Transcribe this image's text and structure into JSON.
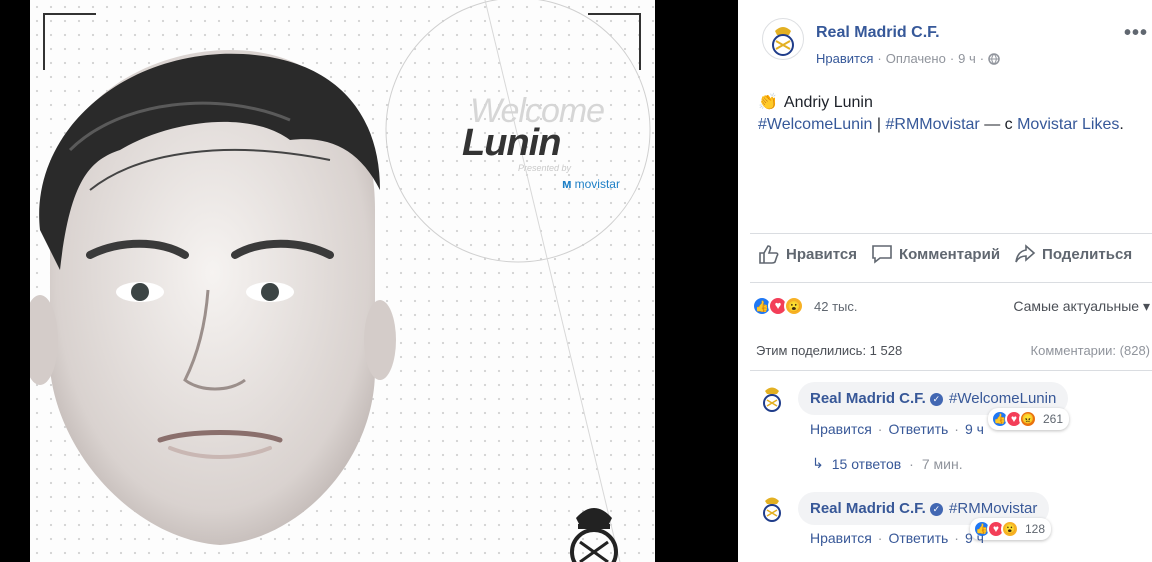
{
  "photo": {
    "welcome": "Welcome",
    "name": "Lunin",
    "presented_by": "Presented by",
    "sponsor": "movistar"
  },
  "post": {
    "page_name": "Real Madrid C.F.",
    "like_link": "Нравится",
    "paid": "Оплачено",
    "time": "9 ч",
    "emoji": "👏",
    "text_name": "Andriy Lunin",
    "hashtag1": "#WelcomeLunin",
    "separator": "|",
    "hashtag2": "#RMMovistar",
    "with_text": "— с",
    "partner": "Movistar Likes",
    "period": "."
  },
  "actions": {
    "like": "Нравится",
    "comment": "Комментарий",
    "share": "Поделиться"
  },
  "reactions": {
    "count": "42 тыс.",
    "sort_label": "Самые актуальные ▾"
  },
  "shares": {
    "shared": "Этим поделились: 1 528",
    "comments": "Комментарии: (828)"
  },
  "comments": [
    {
      "author": "Real Madrid C.F.",
      "text": "#WelcomeLunin",
      "like": "Нравится",
      "reply": "Ответить",
      "dot": "·",
      "time": "9 ч",
      "reactions": "261",
      "replies": "15 ответов",
      "replies_time": "7 мин."
    },
    {
      "author": "Real Madrid C.F.",
      "text": "#RMMovistar",
      "like": "Нравится",
      "reply": "Ответить",
      "dot": "·",
      "time": "9 ч",
      "reactions": "128"
    }
  ],
  "colors": {
    "link": "#365899",
    "like_blue": "#2078f4",
    "love_red": "#f33e58",
    "wow_yellow": "#f7b125"
  }
}
